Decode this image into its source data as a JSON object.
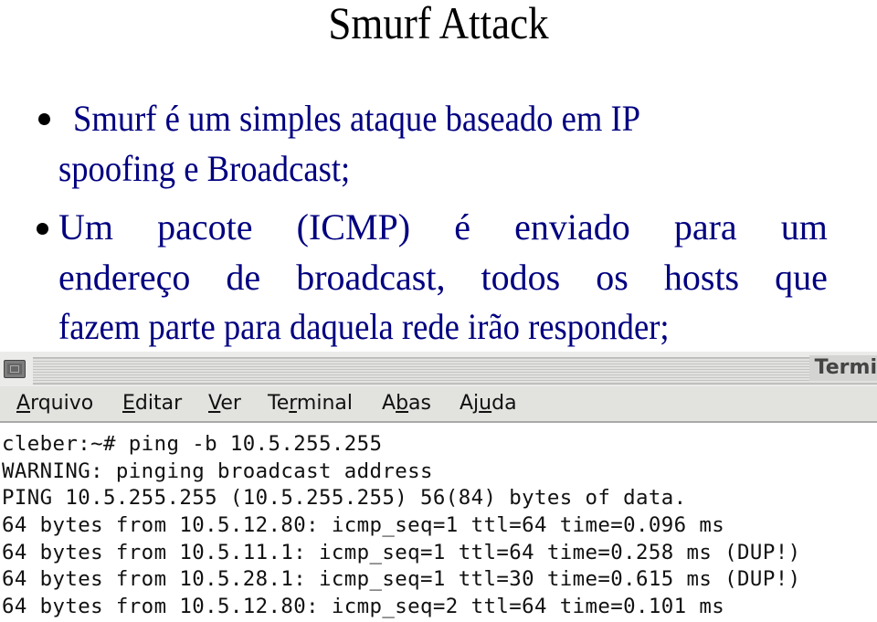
{
  "slide": {
    "title": "Smurf Attack",
    "bullets": [
      {
        "lines": [
          "Smurf é um simples ataque baseado em IP",
          "spoofing e Broadcast;"
        ]
      },
      {
        "line1_words": [
          "Um",
          "pacote",
          "(ICMP)",
          "é",
          "enviado",
          "para",
          "um"
        ],
        "line2_words": [
          "endereço",
          "de",
          "broadcast,",
          "todos",
          "os",
          "hosts",
          "que"
        ],
        "line3": "fazem parte para daquela rede irão responder;"
      }
    ],
    "text_color": "#000080"
  },
  "terminal": {
    "window_title": "Termi",
    "icon": "terminal-window-icon",
    "menu": [
      {
        "pre": "",
        "key": "A",
        "post": "rquivo"
      },
      {
        "pre": "",
        "key": "E",
        "post": "ditar"
      },
      {
        "pre": "",
        "key": "V",
        "post": "er"
      },
      {
        "pre": "Te",
        "key": "r",
        "post": "minal"
      },
      {
        "pre": "A",
        "key": "b",
        "post": "as"
      },
      {
        "pre": "Aj",
        "key": "u",
        "post": "da"
      }
    ],
    "output_lines": [
      "cleber:~# ping -b 10.5.255.255",
      "WARNING: pinging broadcast address",
      "PING 10.5.255.255 (10.5.255.255) 56(84) bytes of data.",
      "64 bytes from 10.5.12.80: icmp_seq=1 ttl=64 time=0.096 ms",
      "64 bytes from 10.5.11.1: icmp_seq=1 ttl=64 time=0.258 ms (DUP!)",
      "64 bytes from 10.5.28.1: icmp_seq=1 ttl=30 time=0.615 ms (DUP!)",
      "64 bytes from 10.5.12.80: icmp_seq=2 ttl=64 time=0.101 ms"
    ]
  }
}
